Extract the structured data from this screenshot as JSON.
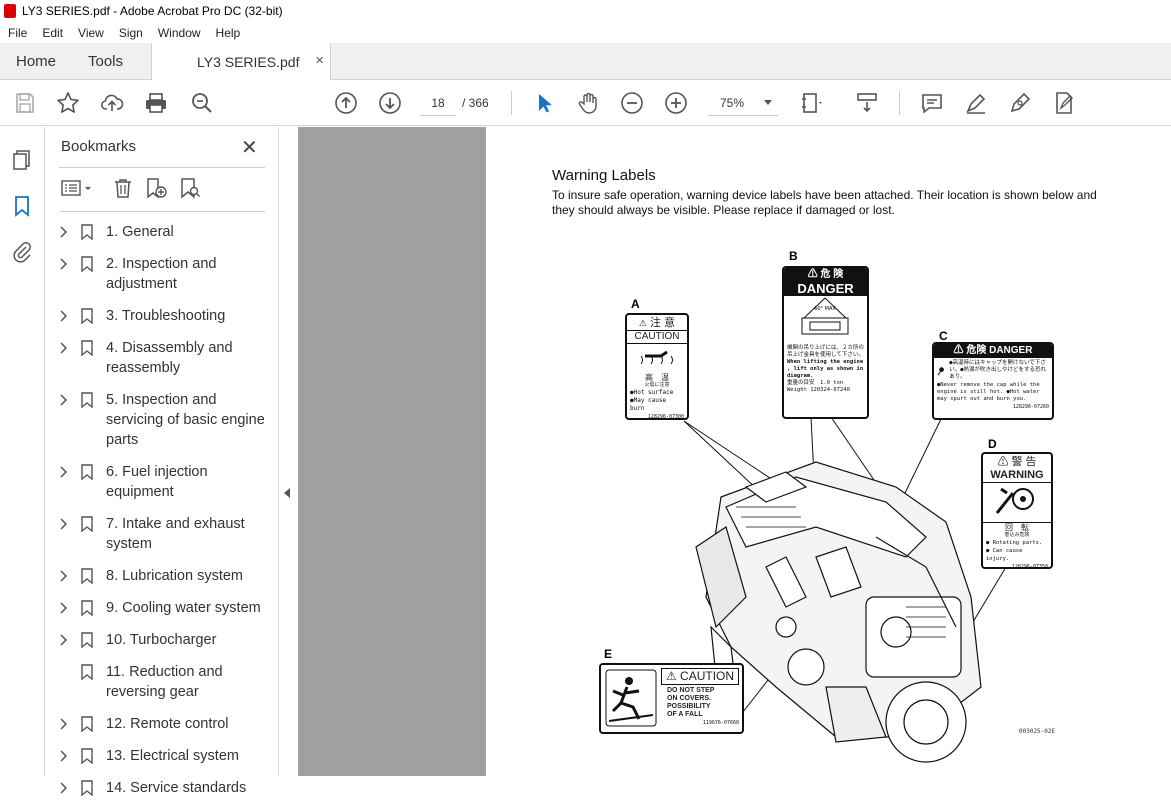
{
  "window": {
    "title": "LY3 SERIES.pdf - Adobe Acrobat Pro DC (32-bit)"
  },
  "menu": [
    "File",
    "Edit",
    "View",
    "Sign",
    "Window",
    "Help"
  ],
  "tabs": {
    "home": "Home",
    "tools": "Tools",
    "document": "LY3 SERIES.pdf",
    "close": "×"
  },
  "toolbar": {
    "page_current": "18",
    "page_total": "/   366",
    "zoom": "75%"
  },
  "bookmarks": {
    "title": "Bookmarks",
    "close": "✕",
    "items": [
      {
        "label": "1. General",
        "expandable": true
      },
      {
        "label": "2. Inspection and adjustment",
        "expandable": true
      },
      {
        "label": "3. Troubleshooting",
        "expandable": true
      },
      {
        "label": "4. Disassembly and reassembly",
        "expandable": true
      },
      {
        "label": "5. Inspection and servicing of basic engine parts",
        "expandable": true
      },
      {
        "label": "6. Fuel injection equipment",
        "expandable": true
      },
      {
        "label": "7. Intake and exhaust system",
        "expandable": true
      },
      {
        "label": "8. Lubrication system",
        "expandable": true
      },
      {
        "label": "9. Cooling water system",
        "expandable": true
      },
      {
        "label": "10. Turbocharger",
        "expandable": true
      },
      {
        "label": "11. Reduction and reversing gear",
        "expandable": false
      },
      {
        "label": "12. Remote control",
        "expandable": true
      },
      {
        "label": "13. Electrical system",
        "expandable": true
      },
      {
        "label": "14. Service standards",
        "expandable": true
      }
    ]
  },
  "document": {
    "heading": "Warning Labels",
    "paragraph": "To insure safe operation, warning device labels have been attached. Their location is shown below and they should always be visible. Please replace if damaged or lost.",
    "labels": {
      "a": {
        "letter": "A",
        "head": "注 意",
        "sub": "CAUTION",
        "jp": "高　温",
        "jp2": "火傷に注意",
        "line1": "●Hot surface",
        "line2": "●May cause burn",
        "code": "128296-07300"
      },
      "b": {
        "letter": "B",
        "head_jp": "危 険",
        "head": "DANGER",
        "angle": "60° MAX",
        "jp": "機関の吊り上げには、２カ所の吊上げ金具を使用して下さい。",
        "en": "When lifting the engine , lift only as shown in diagram.",
        "weight_jp": "重量の目安　1.0 ton",
        "weight": "Weight",
        "code": "120324-07240"
      },
      "c": {
        "letter": "C",
        "head": "危険  DANGER",
        "jp": "●高温時にはキャップを開けないで下さい。●熱湯が吹き出しやけどをする恐れあり。",
        "en": "●Never remove the cap while the engine is still hot. ●Hot water may spurt out and burn you.",
        "code": "128296-07260"
      },
      "d": {
        "letter": "D",
        "head_jp": "警 告",
        "head": "WARNING",
        "jp": "回　転",
        "jp2": "巻込み危険",
        "line1": "● Rotating parts.",
        "line2": "● Can cause injury.",
        "code": "128296-07350"
      },
      "e": {
        "letter": "E",
        "head": "CAUTION",
        "line1": "DO NOT STEP",
        "line2": "ON COVERS.",
        "line3": "POSSIBILITY",
        "line4": "OF A FALL",
        "code": "119676-07660"
      }
    },
    "figure_code": "003025-02E"
  }
}
